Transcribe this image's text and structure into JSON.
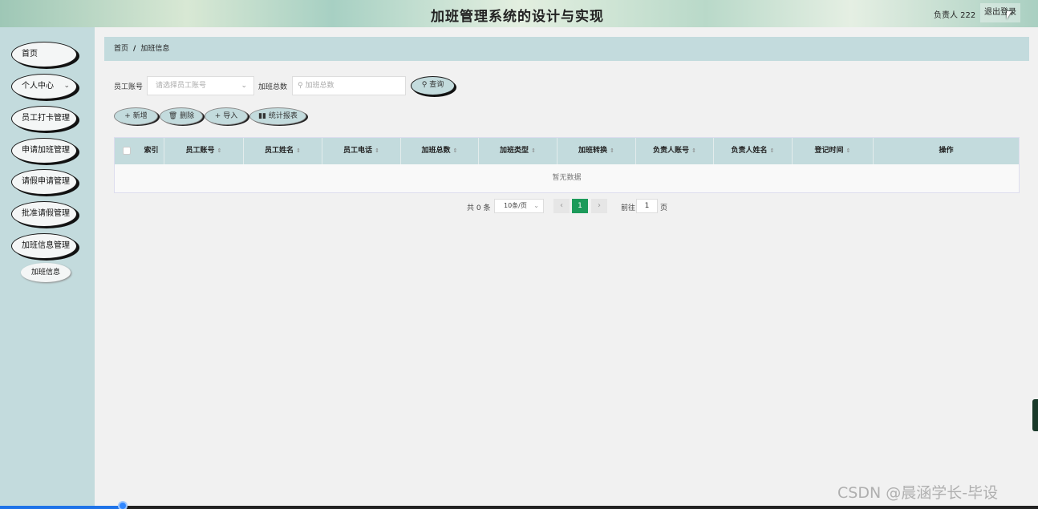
{
  "header": {
    "title": "加班管理系统的设计与实现",
    "user": "负责人 222",
    "logout": "退出登录"
  },
  "sidebar": {
    "items": [
      {
        "label": "首页"
      },
      {
        "label": "个人中心"
      },
      {
        "label": "员工打卡管理"
      },
      {
        "label": "申请加班管理"
      },
      {
        "label": "请假申请管理"
      },
      {
        "label": "批准请假管理"
      },
      {
        "label": "加班信息管理"
      }
    ],
    "submenu": {
      "label": "加班信息"
    }
  },
  "breadcrumb": {
    "home": "首页",
    "separator": "/",
    "current": "加班信息"
  },
  "filters": {
    "account_label": "员工账号",
    "account_placeholder": "请选择员工账号",
    "total_label": "加班总数",
    "total_placeholder": "加班总数",
    "search_label": "查询"
  },
  "actions": {
    "add": "新增",
    "delete": "删除",
    "import": "导入",
    "report": "统计报表"
  },
  "table": {
    "columns": [
      "索引",
      "员工账号",
      "员工姓名",
      "员工电话",
      "加班总数",
      "加班类型",
      "加班转换",
      "负责人账号",
      "负责人姓名",
      "登记时间",
      "操作"
    ],
    "empty_text": "暂无数据"
  },
  "pagination": {
    "total": "共 0 条",
    "page_size": "10条/页",
    "current_page": "1",
    "goto_label": "前往",
    "goto_value": "1",
    "page_unit": "页"
  },
  "watermark": "CSDN @晨涵学长-毕设"
}
